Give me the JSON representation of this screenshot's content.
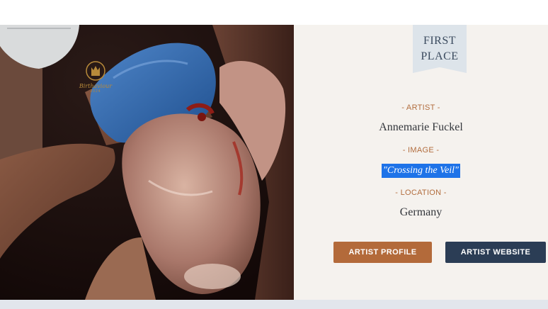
{
  "award": {
    "line1": "FIRST",
    "line2": "PLACE"
  },
  "logo": {
    "script_text": "Birthaviour",
    "sub_text": "2024"
  },
  "details": {
    "artist_label": "- ARTIST -",
    "artist_name": "Annemarie Fuckel",
    "image_label": "- IMAGE -",
    "image_title": "\"Crossing the Veil\"",
    "location_label": "- LOCATION -",
    "location_value": "Germany"
  },
  "buttons": {
    "profile_label": "ARTIST PROFILE",
    "website_label": "ARTIST WEBSITE"
  },
  "colors": {
    "panel_bg": "#f5f2ee",
    "accent_copper": "#b36a3a",
    "accent_navy": "#2b3d55",
    "ribbon": "#dde4ea",
    "selection": "#1e73e8"
  }
}
